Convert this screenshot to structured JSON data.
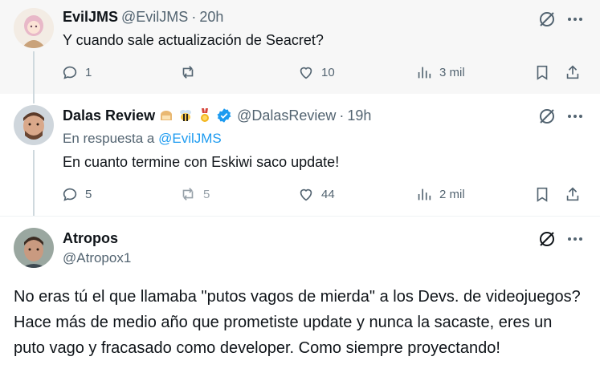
{
  "tweets": [
    {
      "name": "EvilJMS",
      "handle": "@EvilJMS",
      "separator": "·",
      "time": "20h",
      "text": "Y cuando sale actualización de Seacret?",
      "replies": "1",
      "reposts": "",
      "likes": "10",
      "views": "3 mil"
    },
    {
      "name": "Dalas Review",
      "handle": "@DalasReview",
      "separator": "·",
      "time": "19h",
      "reply_prefix": "En respuesta a",
      "reply_mention": "@EvilJMS",
      "text": "En cuanto termine con Eskiwi saco update!",
      "replies": "5",
      "reposts": "5",
      "likes": "44",
      "views": "2 mil",
      "badges": [
        "bread-emoji-icon",
        "bee-emoji-icon",
        "medal-emoji-icon"
      ]
    },
    {
      "name": "Atropos",
      "handle": "@Atropox1",
      "text": "No eras tú el que llamaba \"putos vagos de mierda\" a los Devs. de videojuegos? Hace más de medio año que prometiste update y nunca la sacaste, eres un puto vago y fracasado como developer. Como siempre proyectando!"
    }
  ],
  "colors": {
    "muted": "#536471",
    "link": "#1d9bf0",
    "verified": "#1d9bf0",
    "highlight_bg": "#f7f7f7"
  }
}
